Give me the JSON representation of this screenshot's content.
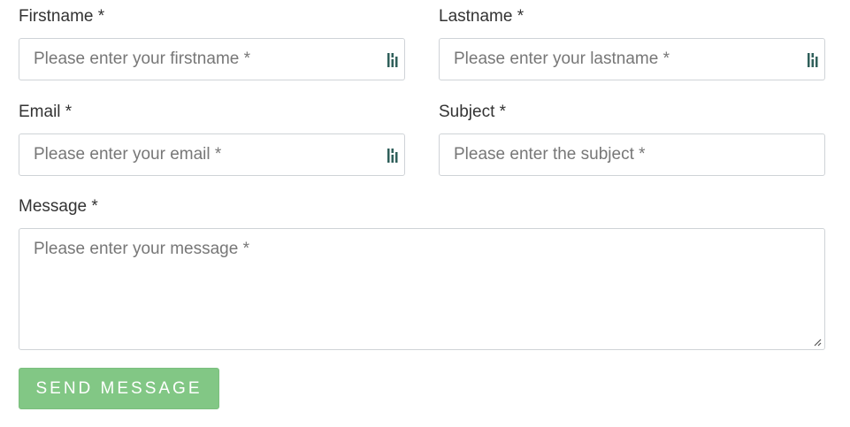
{
  "form": {
    "firstname": {
      "label": "Firstname *",
      "placeholder": "Please enter your firstname *",
      "value": "",
      "icon": "password-manager-icon"
    },
    "lastname": {
      "label": "Lastname *",
      "placeholder": "Please enter your lastname *",
      "value": "",
      "icon": "password-manager-icon"
    },
    "email": {
      "label": "Email *",
      "placeholder": "Please enter your email *",
      "value": "",
      "icon": "password-manager-icon"
    },
    "subject": {
      "label": "Subject *",
      "placeholder": "Please enter the subject *",
      "value": ""
    },
    "message": {
      "label": "Message *",
      "placeholder": "Please enter your message *",
      "value": "",
      "icon": "resize-handle-icon"
    },
    "submit": {
      "label": "SEND MESSAGE",
      "color": "#82c785"
    }
  }
}
